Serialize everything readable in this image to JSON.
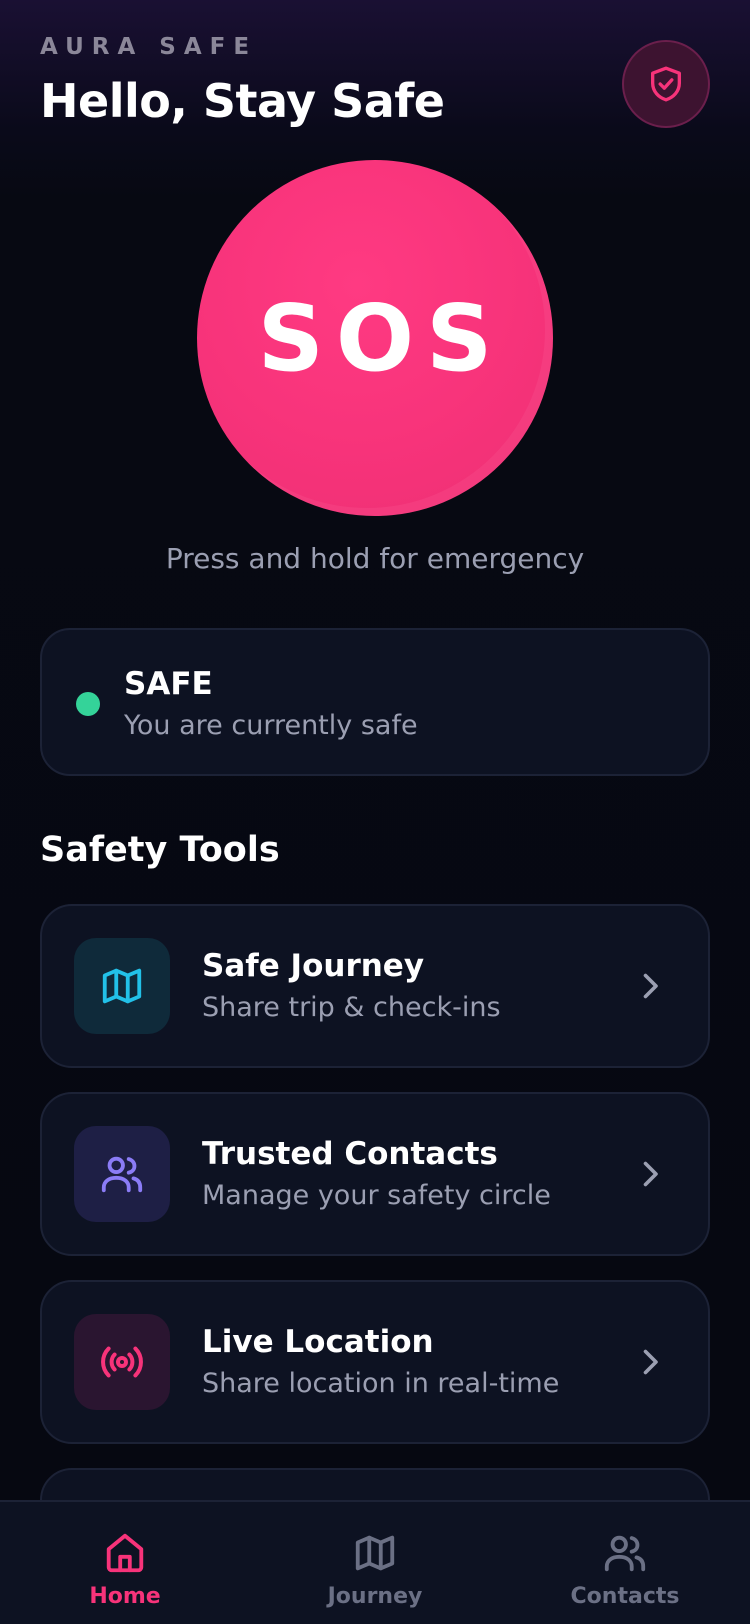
{
  "header": {
    "brand": "AURA SAFE",
    "greeting": "Hello, Stay Safe"
  },
  "sos": {
    "label": "SOS",
    "hint": "Press and hold for emergency"
  },
  "status": {
    "title": "SAFE",
    "subtitle": "You are currently safe",
    "color": "#34d399"
  },
  "tools": {
    "section_title": "Safety Tools",
    "items": [
      {
        "title": "Safe Journey",
        "subtitle": "Share trip & check-ins",
        "icon": "map-icon",
        "accent": "#22c1e8"
      },
      {
        "title": "Trusted Contacts",
        "subtitle": "Manage your safety circle",
        "icon": "users-icon",
        "accent": "#8b7cf6"
      },
      {
        "title": "Live Location",
        "subtitle": "Share location in real-time",
        "icon": "broadcast-icon",
        "accent": "#f7337a"
      }
    ]
  },
  "nav": {
    "items": [
      {
        "label": "Home",
        "icon": "home-icon",
        "active": true
      },
      {
        "label": "Journey",
        "icon": "map-icon",
        "active": false
      },
      {
        "label": "Contacts",
        "icon": "users-icon",
        "active": false
      }
    ]
  },
  "colors": {
    "accent": "#f7337a",
    "background": "#060811",
    "card": "#0d1222",
    "muted": "#9b9fb2"
  }
}
